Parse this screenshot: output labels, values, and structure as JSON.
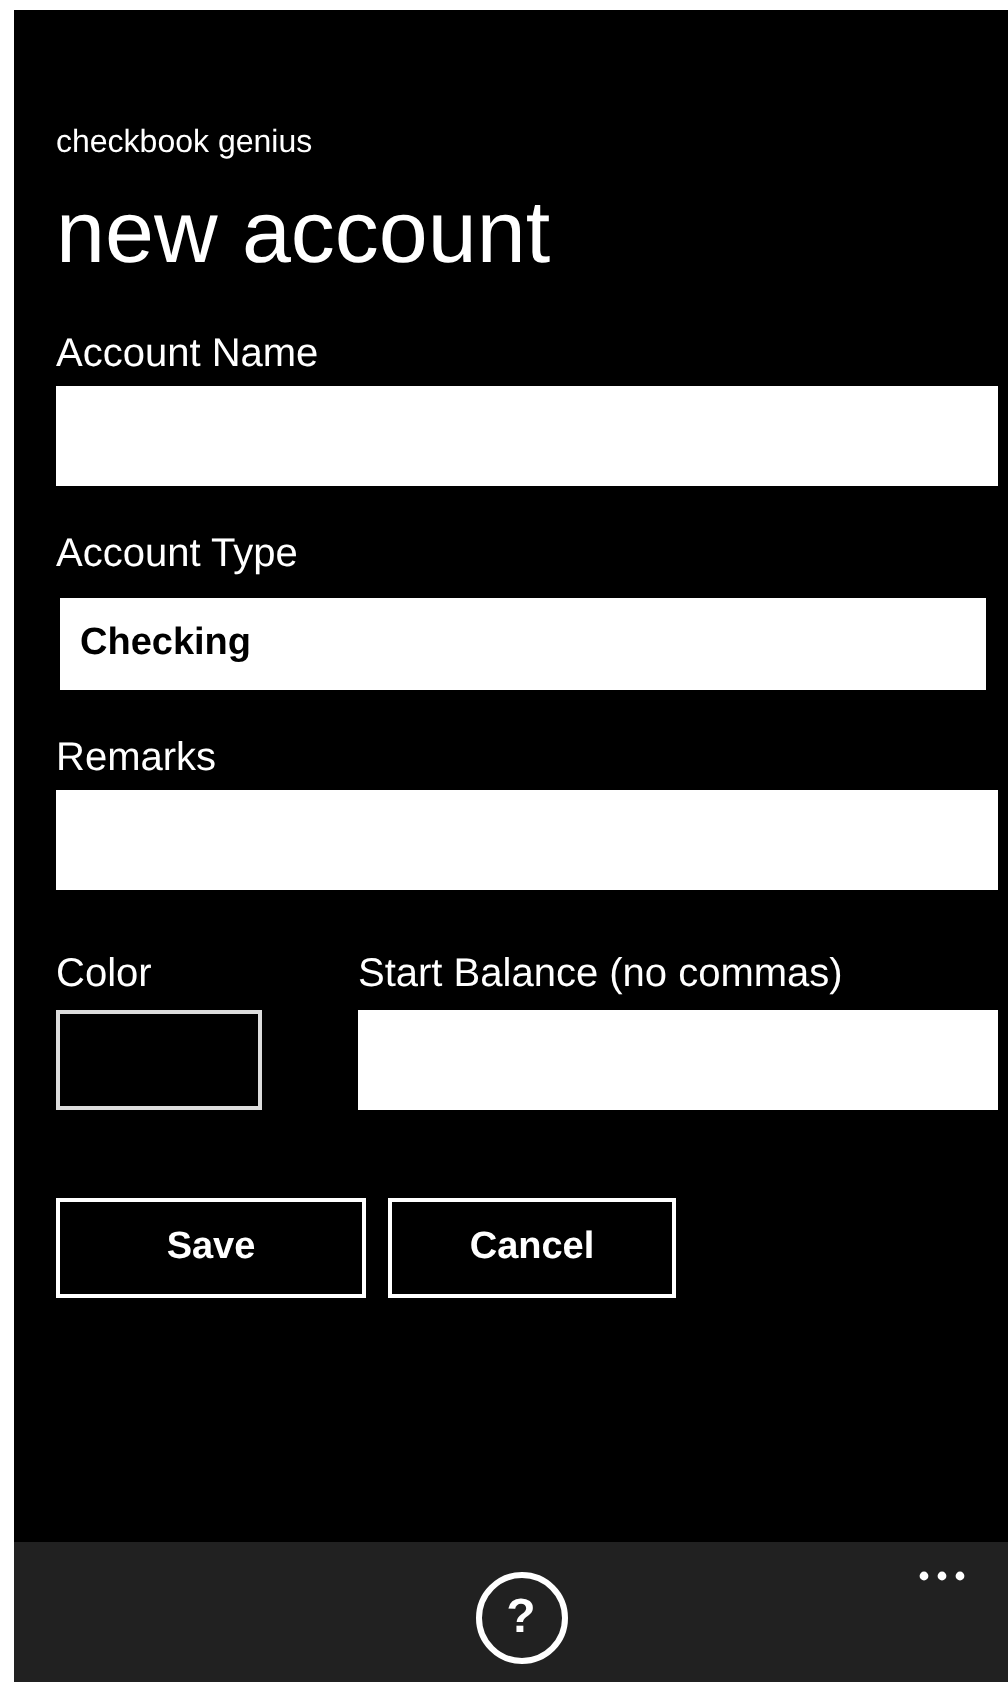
{
  "app_name": "checkbook genius",
  "page_title": "new account",
  "fields": [
    {
      "kind": "text",
      "label": "Account Name"
    },
    {
      "kind": "picker",
      "label": "Account Type",
      "value": "Checking"
    },
    {
      "kind": "text",
      "label": "Remarks"
    }
  ],
  "color_field": {
    "label": "Color"
  },
  "balance_field": {
    "label": "Start Balance (no commas)"
  },
  "buttons": [
    "Save",
    "Cancel"
  ],
  "app_bar": {
    "help": "?"
  }
}
